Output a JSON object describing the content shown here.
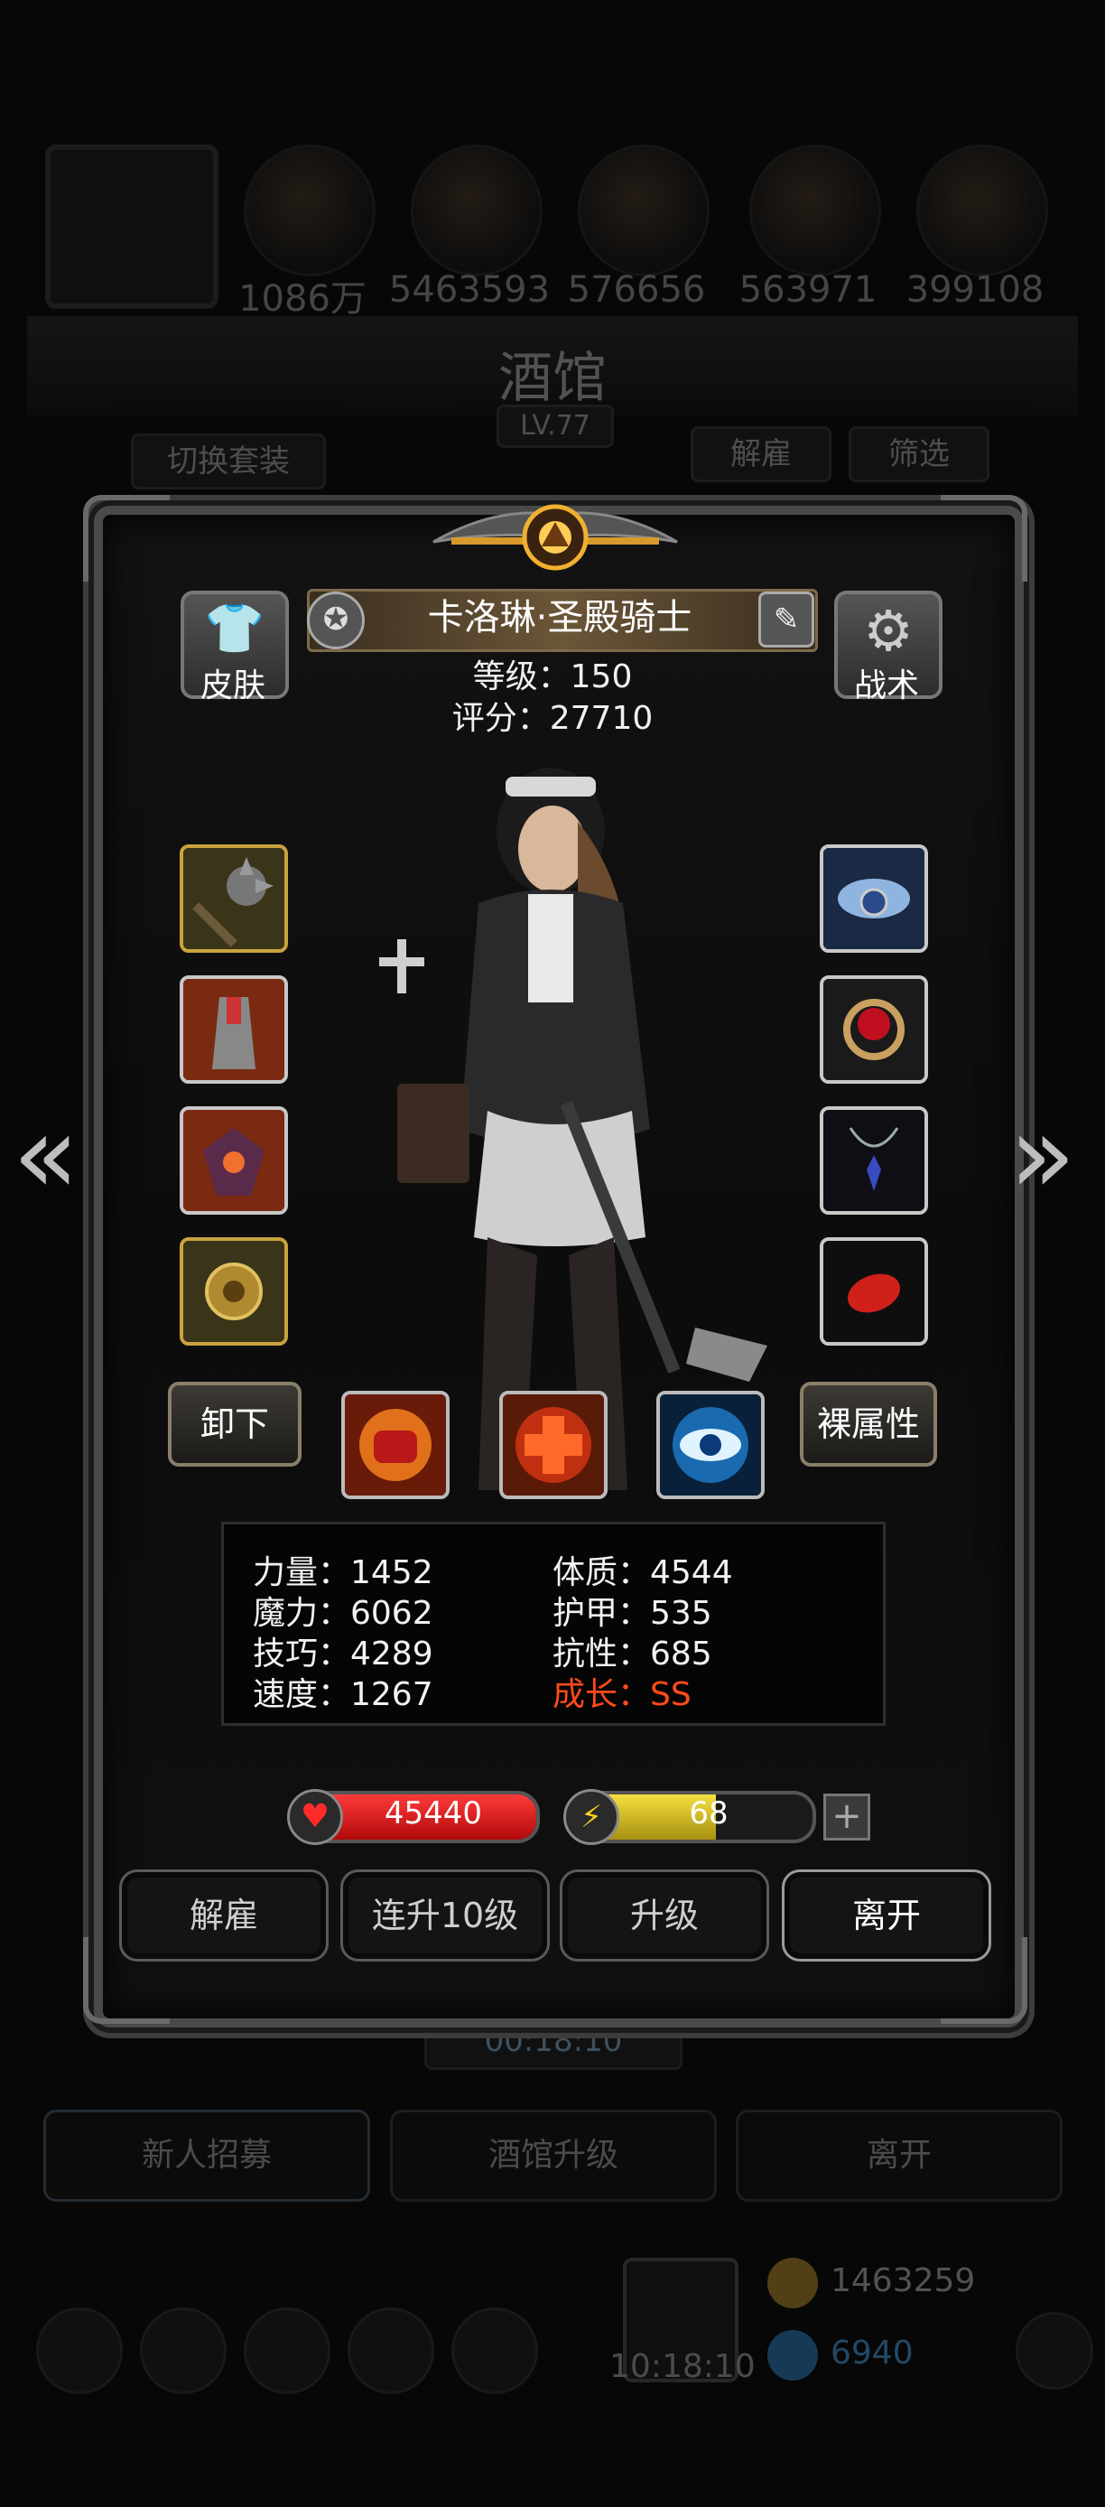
{
  "background": {
    "resources": [
      "1086万",
      "5463593",
      "576656",
      "563971",
      "399108"
    ],
    "tavern_title": "酒馆",
    "tavern_level": "LV.77",
    "switch_outfit": "切换套装",
    "dismiss_label": "解雇",
    "filter_label": "筛选",
    "timer": "00:18:10",
    "bottom_buttons": [
      "新人招募",
      "酒馆升级",
      "离开"
    ],
    "gold": "1463259",
    "gems": "6940",
    "timer2": "10:18:10"
  },
  "hero": {
    "name": "卡洛琳·圣殿骑士",
    "level_text": "等级：150",
    "score_text": "评分：27710"
  },
  "buttons": {
    "skin": "皮肤",
    "tactics": "战术",
    "unequip": "卸下",
    "naked_stats": "裸属性"
  },
  "stats": {
    "strength": "力量：1452",
    "magic": "魔力：6062",
    "skill": "技巧：4289",
    "speed": "速度：1267",
    "constitution": "体质：4544",
    "armor": "护甲：535",
    "resistance": "抗性：685",
    "growth": "成长：SS"
  },
  "bars": {
    "hp": "45440",
    "energy": "68",
    "energy_fraction": 0.6
  },
  "actions": [
    "解雇",
    "连升10级",
    "升级",
    "离开"
  ],
  "icons": {
    "left_equipment": [
      "mace-icon",
      "cloak-icon",
      "demon-armor-icon",
      "golden-emblem-icon"
    ],
    "right_equipment": [
      "water-ring-icon",
      "ruby-ring-icon",
      "pendant-icon",
      "red-gem-icon"
    ],
    "skills": [
      "fist-icon",
      "red-cross-icon",
      "eye-icon"
    ]
  },
  "colors": {
    "hp_bar": "#d01818",
    "energy_bar": "#d8c21a",
    "growth": "#ff4a1a",
    "gold_frame": "#c9a33f"
  }
}
